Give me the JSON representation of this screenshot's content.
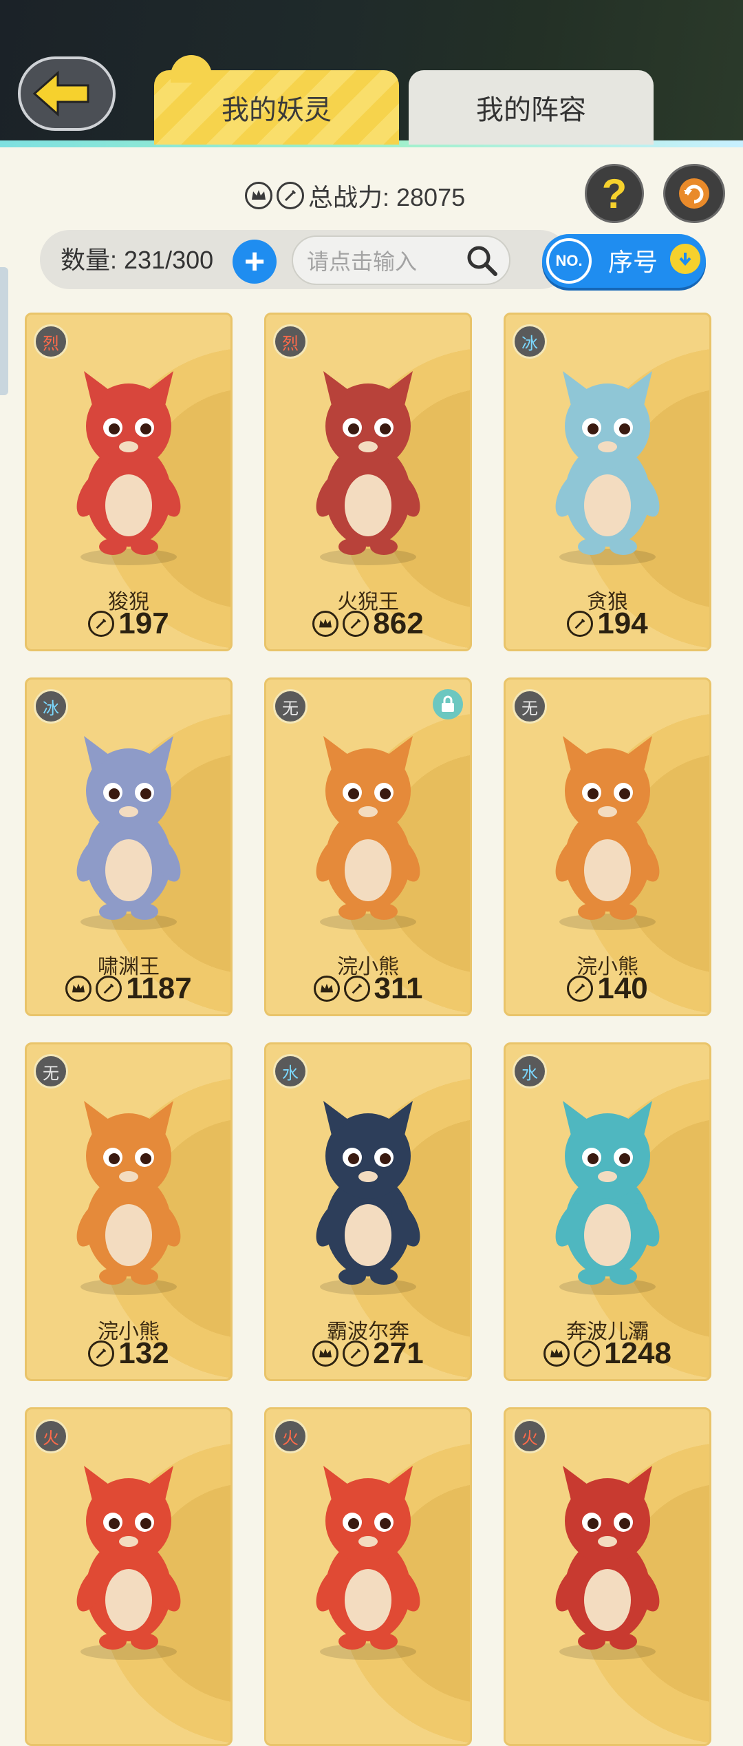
{
  "tabs": [
    {
      "label": "我的妖灵",
      "active": true
    },
    {
      "label": "我的阵容",
      "active": false
    }
  ],
  "summary": {
    "total_power_label": "总战力: 28075"
  },
  "filter": {
    "count_label": "数量: 231/300",
    "add_label": "+",
    "search_placeholder": "请点击输入",
    "sort_no": "NO.",
    "sort_label": "序号"
  },
  "help_label": "?",
  "cards": [
    {
      "element": "烈",
      "element_color": "red",
      "name": "狻猊",
      "power": "197",
      "crown": false,
      "locked": false,
      "body_color": "#d8463c"
    },
    {
      "element": "烈",
      "element_color": "red",
      "name": "火猊王",
      "power": "862",
      "crown": true,
      "locked": false,
      "body_color": "#b8423a"
    },
    {
      "element": "冰",
      "element_color": "blue",
      "name": "贪狼",
      "power": "194",
      "crown": false,
      "locked": false,
      "body_color": "#8fc6d6"
    },
    {
      "element": "冰",
      "element_color": "blue",
      "name": "啸渊王",
      "power": "1187",
      "crown": true,
      "locked": false,
      "body_color": "#8e9bc8"
    },
    {
      "element": "无",
      "element_color": "white",
      "name": "浣小熊",
      "power": "311",
      "crown": true,
      "locked": true,
      "body_color": "#e58a3a"
    },
    {
      "element": "无",
      "element_color": "white",
      "name": "浣小熊",
      "power": "140",
      "crown": false,
      "locked": false,
      "body_color": "#e58a3a"
    },
    {
      "element": "无",
      "element_color": "white",
      "name": "浣小熊",
      "power": "132",
      "crown": false,
      "locked": false,
      "body_color": "#e58a3a"
    },
    {
      "element": "水",
      "element_color": "blue",
      "name": "霸波尔奔",
      "power": "271",
      "crown": true,
      "locked": false,
      "body_color": "#2d3e5a"
    },
    {
      "element": "水",
      "element_color": "blue",
      "name": "奔波儿灞",
      "power": "1248",
      "crown": true,
      "locked": false,
      "body_color": "#4fb7c0"
    },
    {
      "element": "火",
      "element_color": "red",
      "name": "",
      "power": "",
      "crown": false,
      "locked": false,
      "body_color": "#e04a34"
    },
    {
      "element": "火",
      "element_color": "red",
      "name": "",
      "power": "",
      "crown": false,
      "locked": false,
      "body_color": "#e04a34"
    },
    {
      "element": "火",
      "element_color": "red",
      "name": "",
      "power": "",
      "crown": false,
      "locked": false,
      "body_color": "#c83a30"
    }
  ]
}
